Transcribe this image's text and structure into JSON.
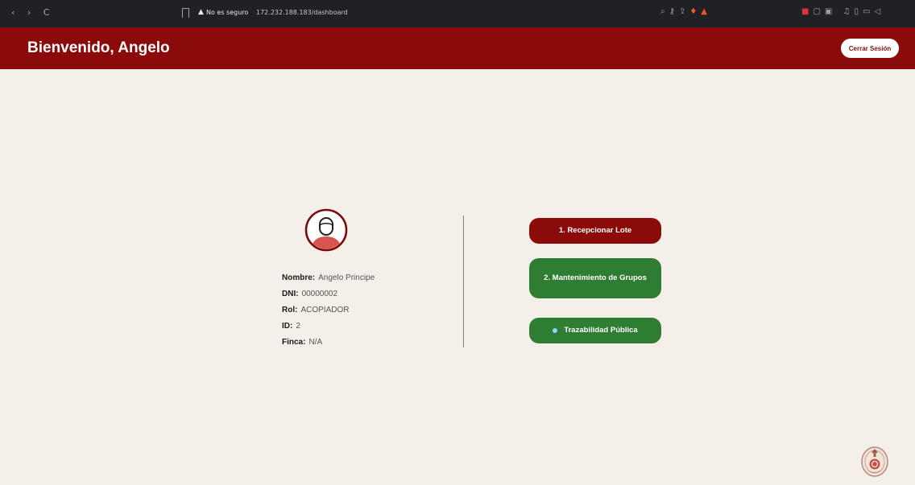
{
  "browser": {
    "nav_glyphs": "‹ › C",
    "warning_glyph": "▲",
    "security_label": "No es seguro",
    "url": "172.232.188.183/dashboard"
  },
  "header": {
    "title": "Bienvenido, Angelo",
    "logout_label": "Cerrar Sesión",
    "color": "#8b0a0a"
  },
  "profile": {
    "fields": [
      {
        "label": "Nombre:",
        "value": "Angelo Principe"
      },
      {
        "label": "DNI:",
        "value": "00000002"
      },
      {
        "label": "Rol:",
        "value": "ACOPIADOR"
      },
      {
        "label": "ID:",
        "value": "2"
      },
      {
        "label": "Finca:",
        "value": "N/A"
      }
    ]
  },
  "actions": {
    "receive_lot": "1. Recepcionar Lote",
    "group_maintenance": "2. Mantenimiento de Grupos",
    "public_traceability": "Trazabilidad Pública"
  },
  "colors": {
    "primary": "#8b0a0a",
    "success": "#2f7d32",
    "background": "#f4efe9"
  }
}
